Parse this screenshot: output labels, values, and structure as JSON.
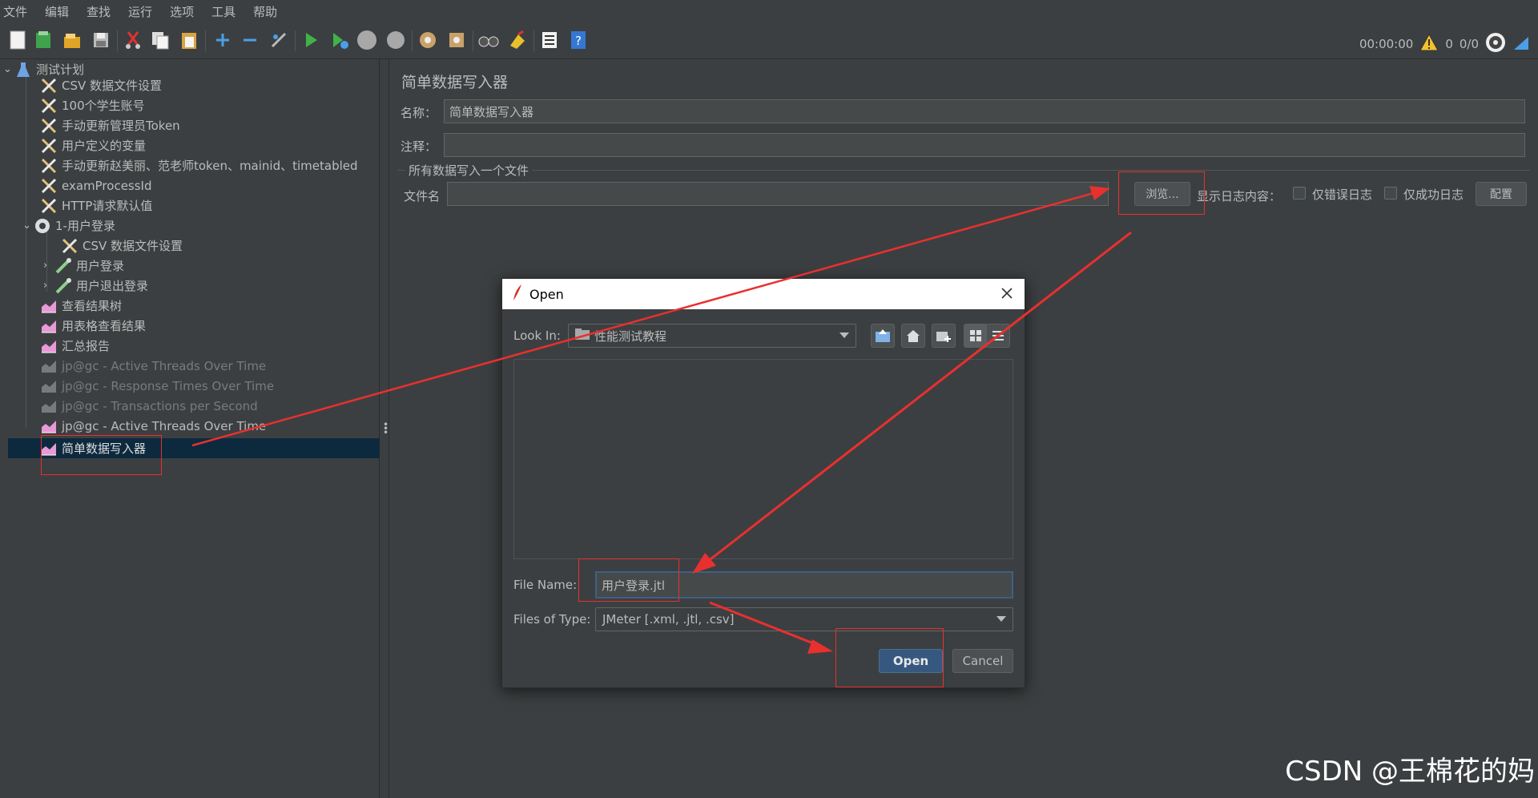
{
  "menu": [
    "文件",
    "编辑",
    "查找",
    "运行",
    "选项",
    "工具",
    "帮助"
  ],
  "toolbar": {
    "timer": "00:00:00",
    "warning_count": "0",
    "thread_count": "0/0"
  },
  "tree": {
    "root": "测试计划",
    "items": [
      "CSV 数据文件设置",
      "100个学生账号",
      "手动更新管理员Token",
      "用户定义的变量",
      "手动更新赵美丽、范老师token、mainid、timetabled",
      "examProcessId",
      "HTTP请求默认值",
      "1-用户登录",
      "CSV 数据文件设置",
      "用户登录",
      "用户退出登录",
      "查看结果树",
      "用表格查看结果",
      "汇总报告",
      "jp@gc - Active Threads Over Time",
      "jp@gc - Response Times Over Time",
      "jp@gc - Transactions per Second",
      "jp@gc - Active Threads Over Time",
      "简单数据写入器"
    ]
  },
  "panel": {
    "title": "简单数据写入器",
    "name_label": "名称：",
    "name_value": "简单数据写入器",
    "comment_label": "注释：",
    "comment_value": "",
    "group_title": "所有数据写入一个文件",
    "filename_label": "文件名",
    "filename_value": "",
    "browse_button": "浏览...",
    "log_display_label": "显示日志内容：",
    "errors_only_label": "仅错误日志",
    "success_only_label": "仅成功日志",
    "configure_button": "配置"
  },
  "dialog": {
    "title": "Open",
    "look_in_label": "Look In:",
    "look_in_value": "性能测试教程",
    "file_name_label": "File Name:",
    "file_name_value": "用户登录.jtl",
    "files_of_type_label": "Files of Type:",
    "files_of_type_value": "JMeter [.xml, .jtl, .csv]",
    "open_button": "Open",
    "cancel_button": "Cancel"
  },
  "watermark": "CSDN @王棉花的妈",
  "colors": {
    "background": "#3c3f41",
    "selection": "#0d293e",
    "annotation_red": "#e8302f",
    "open_button": "#365880"
  }
}
